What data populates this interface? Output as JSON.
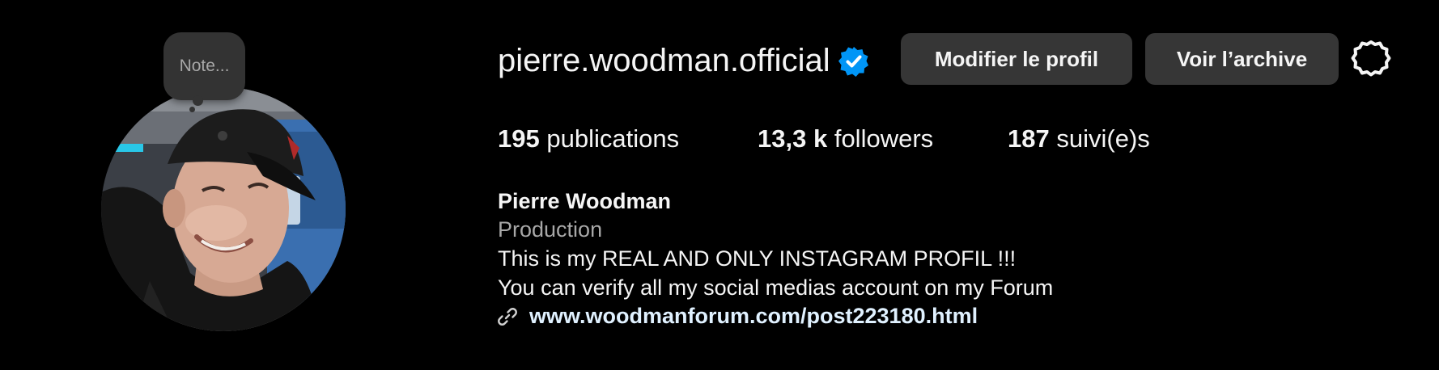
{
  "profile": {
    "note_placeholder": "Note...",
    "username": "pierre.woodman.official",
    "verified": true,
    "verified_color": "#0095f6",
    "icons": {
      "verified": "verified-badge-icon",
      "settings": "gear-icon",
      "link": "link-icon",
      "avatar": "profile-photo"
    }
  },
  "actions": {
    "edit_label": "Modifier le profil",
    "archive_label": "Voir l’archive"
  },
  "stats": {
    "posts_count": "195",
    "posts_label": "publications",
    "followers_count": "13,3 k",
    "followers_label": "followers",
    "following_count": "187",
    "following_label": "suivi(e)s"
  },
  "bio": {
    "name": "Pierre Woodman",
    "category": "Production",
    "lines": [
      "This is my REAL AND ONLY INSTAGRAM PROFIL !!!",
      "You can verify all my social medias account on my Forum"
    ],
    "link": "www.woodmanforum.com/post223180.html"
  },
  "colors": {
    "background": "#000000",
    "button_bg": "#363636",
    "text_primary": "#f5f5f5",
    "text_secondary": "#a8a8a8",
    "link_text": "#e0f1ff"
  }
}
